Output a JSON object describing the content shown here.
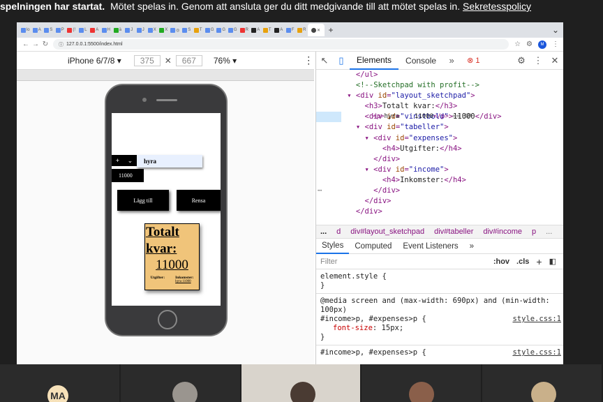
{
  "banner": {
    "bold": "spelningen har startat.",
    "text": "Mötet spelas in. Genom att ansluta ger du ditt medgivande till att mötet spelas in.",
    "link": "Sekretesspolicy"
  },
  "browser": {
    "tabs": [
      "lo",
      "A",
      "S",
      "P",
      "(!",
      "L",
      "A",
      "H",
      "ä",
      "J",
      "J",
      "X",
      "X",
      "◎",
      "S",
      "T",
      "G",
      "G",
      "G",
      "R",
      "A",
      "T",
      "A",
      "F",
      "R"
    ],
    "url": "127.0.0.1:5500/index.html",
    "profile_initial": "M"
  },
  "device_toolbar": {
    "device": "iPhone 6/7/8",
    "width": "375",
    "height": "667",
    "zoom": "76%"
  },
  "app": {
    "select_label": "+",
    "name_value": "hyra",
    "amount_value": "11000",
    "add_button": "Lägg till",
    "clear_button": "Rensa",
    "sketch_title": "Totalt kvar:",
    "profit": "11000",
    "expenses_title": "Utgifter:",
    "income_title": "Inkomster:",
    "income_item": "hyra 11000"
  },
  "devtools": {
    "tabs": {
      "elements": "Elements",
      "console": "Console"
    },
    "error_count": "1",
    "dom_lines": [
      {
        "indent": "      ",
        "html": "</ul>"
      },
      {
        "indent": "      ",
        "html": "<!--Sketchpad with profit-->"
      },
      {
        "indent": "    ▾ ",
        "html": "<div id=\"layout_sketchpad\">"
      },
      {
        "indent": "        ",
        "html": "<h3>Totalt kvar:</h3>"
      },
      {
        "indent": "        ",
        "html": "<div id=\"vinstbold\">11000</div>"
      },
      {
        "indent": "      ▾ ",
        "html": "<div id=\"tabeller\">"
      },
      {
        "indent": "        ▾ ",
        "html": "<div id=\"expenses\">"
      },
      {
        "indent": "            ",
        "html": "<h4>Utgifter:</h4>"
      },
      {
        "indent": "          ",
        "html": "</div>"
      },
      {
        "indent": "        ▾ ",
        "html": "<div id=\"income\">"
      },
      {
        "indent": "            ",
        "html": "<h4>Inkomster:</h4>"
      },
      {
        "indent": "            ",
        "html": "<p>hyra    11000</p> == $0"
      },
      {
        "indent": "          ",
        "html": "</div>"
      },
      {
        "indent": "        ",
        "html": "</div>"
      },
      {
        "indent": "      ",
        "html": "</div>"
      }
    ],
    "breadcrumbs": [
      "...",
      "d",
      "div#layout_sketchpad",
      "div#tabeller",
      "div#income",
      "p",
      "..."
    ],
    "styles_tabs": {
      "styles": "Styles",
      "computed": "Computed",
      "listeners": "Event Listeners"
    },
    "filter_placeholder": "Filter",
    "hov": ":hov",
    "cls": ".cls",
    "rules": {
      "element_style": "element.style {",
      "close": "}",
      "media": "@media screen and (max-width: 690px) and (min-width: 100px)",
      "selector": "#income>p, #expenses>p {",
      "source": "style.css:1",
      "prop": "font-size: 15px;",
      "selector2": "#income>p, #expenses>p {"
    }
  },
  "participants": {
    "initials": "MA"
  }
}
